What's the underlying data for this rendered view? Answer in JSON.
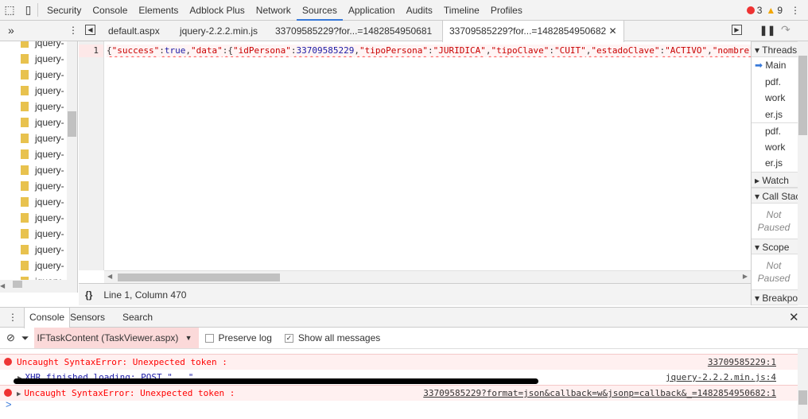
{
  "panels": [
    "Security",
    "Console",
    "Elements",
    "Adblock Plus",
    "Network",
    "Sources",
    "Application",
    "Audits",
    "Timeline",
    "Profiles"
  ],
  "active_panel": "Sources",
  "counts": {
    "errors": "3",
    "warnings": "9"
  },
  "file_tabs": [
    "default.aspx",
    "jquery-2.2.2.min.js",
    "33709585229?for...=1482854950681",
    "33709585229?for...=1482854950682"
  ],
  "tree_item": "jquery-",
  "tree_count": 16,
  "editor": {
    "line_number": "1",
    "code": [
      [
        "p",
        "{"
      ],
      [
        "k",
        "\"success\""
      ],
      [
        "p",
        ":"
      ],
      [
        "n",
        "true"
      ],
      [
        "p",
        ","
      ],
      [
        "k",
        "\"data\""
      ],
      [
        "p",
        ":{"
      ],
      [
        "k",
        "\"idPersona\""
      ],
      [
        "p",
        ":"
      ],
      [
        "n",
        "33709585229"
      ],
      [
        "p",
        ","
      ],
      [
        "k",
        "\"tipoPersona\""
      ],
      [
        "p",
        ":"
      ],
      [
        "s",
        "\"JURIDICA\""
      ],
      [
        "p",
        ","
      ],
      [
        "k",
        "\"tipoClave\""
      ],
      [
        "p",
        ":"
      ],
      [
        "s",
        "\"CUIT\""
      ],
      [
        "p",
        ","
      ],
      [
        "k",
        "\"estadoClave\""
      ],
      [
        "p",
        ":"
      ],
      [
        "s",
        "\"ACTIVO\""
      ],
      [
        "p",
        ","
      ],
      [
        "k",
        "\"nombre\""
      ]
    ]
  },
  "status": {
    "cursor": "Line 1, Column 470",
    "format_icon": "{}"
  },
  "sidebar": {
    "threads": "Threads",
    "main": "Main",
    "items": [
      "pdf.",
      "work",
      "er.js",
      "pdf.",
      "work",
      "er.js"
    ],
    "watch": "Watch",
    "callstack": "Call Stack",
    "not_paused": "Not Paused",
    "scope": "Scope",
    "breakpoints": "Breakpoints"
  },
  "drawer": {
    "tabs": [
      "Console",
      "Sensors",
      "Search"
    ],
    "context": "IFTaskContent (TaskViewer.aspx)",
    "preserve_log": "Preserve log",
    "show_all": "Show all messages"
  },
  "messages": [
    {
      "text": "Uncaught SyntaxError: Unexpected token :",
      "source": "33709585229:1"
    },
    {
      "text": "XHR finished loading: POST \"...\"",
      "source": "jquery-2.2.2.min.js:4"
    },
    {
      "text": "Uncaught SyntaxError: Unexpected token :",
      "source": "33709585229?format=json&callback=w&jsonp=callback&_=1482854950682:1"
    }
  ],
  "prompt": ">"
}
